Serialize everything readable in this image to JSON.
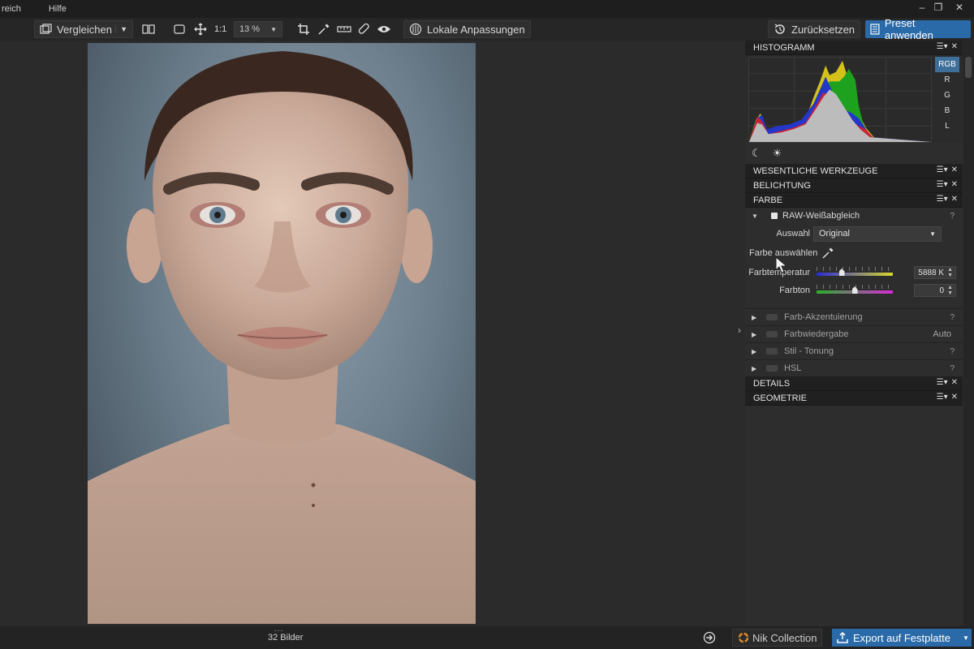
{
  "menubar": {
    "items": [
      "reich",
      "Hilfe"
    ]
  },
  "window_controls": {
    "minimize": "–",
    "restore": "❐",
    "close": "✕"
  },
  "toolbar": {
    "compare_label": "Vergleichen",
    "zoom_one_label": "1:1",
    "zoom_value": "13 %",
    "local_adjust_label": "Lokale Anpassungen",
    "reset_label": "Zurücksetzen",
    "apply_preset_label": "Preset anwenden"
  },
  "panel": {
    "histogram": {
      "title": "HISTOGRAMM",
      "channels": [
        "RGB",
        "R",
        "G",
        "B",
        "L"
      ],
      "active_channel": "RGB"
    },
    "sections": {
      "essentials": "WESENTLICHE WERKZEUGE",
      "exposure": "BELICHTUNG",
      "color": "FARBE",
      "details": "DETAILS",
      "geometry": "GEOMETRIE"
    },
    "white_balance": {
      "title": "RAW-Weißabgleich",
      "help": "?",
      "selection_label": "Auswahl",
      "selection_value": "Original",
      "pick_color_label": "Farbe auswählen",
      "temperature_label": "Farbtemperatur",
      "temperature_value": "5888 K",
      "temperature_position": 0.33,
      "tint_label": "Farbton",
      "tint_value": "0",
      "tint_position": 0.5
    },
    "subsections": [
      {
        "label": "Farb-Akzentuierung",
        "right": "?"
      },
      {
        "label": "Farbwiedergabe",
        "right": "Auto"
      },
      {
        "label": "Stil - Tonung",
        "right": "?"
      },
      {
        "label": "HSL",
        "right": "?"
      }
    ]
  },
  "bottombar": {
    "dots": "...",
    "image_count": "32 Bilder",
    "nik_label": "Nik Collection",
    "export_label": "Export auf Festplatte"
  },
  "colors": {
    "accent": "#2a6aa8",
    "panel_bg": "#2d2d2d",
    "header_bg": "#202020",
    "active_channel": "#3d6f9a"
  }
}
